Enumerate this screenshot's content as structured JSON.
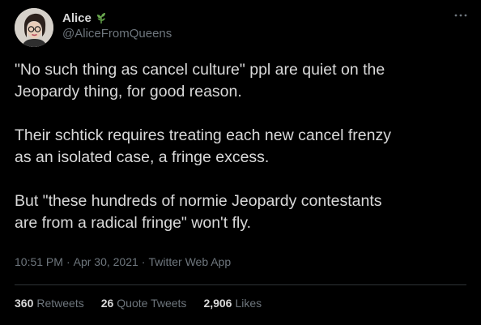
{
  "author": {
    "display_name": "Alice",
    "handle": "@AliceFromQueens",
    "avatar_icon": "profile-photo",
    "name_emoji_icon": "herb-icon"
  },
  "tweet": {
    "paragraphs": [
      "\"No such thing as cancel culture\" ppl are quiet on the\nJeopardy thing, for good reason.",
      "Their schtick requires treating each new cancel frenzy\nas an isolated case, a fringe excess.",
      "But \"these hundreds of normie Jeopardy contestants\nare from a radical fringe\" won't fly."
    ],
    "time": "10:51 PM",
    "date": "Apr 30, 2021",
    "source": "Twitter Web App",
    "separator": "·"
  },
  "stats": {
    "retweets_count": "360",
    "retweets_label": "Retweets",
    "quotes_count": "26",
    "quotes_label": "Quote Tweets",
    "likes_count": "2,906",
    "likes_label": "Likes"
  },
  "colors": {
    "background": "#000000",
    "text": "#d9d9d9",
    "secondary": "#6e767d",
    "divider": "#2f3336",
    "emoji_green": "#6aa84f"
  }
}
